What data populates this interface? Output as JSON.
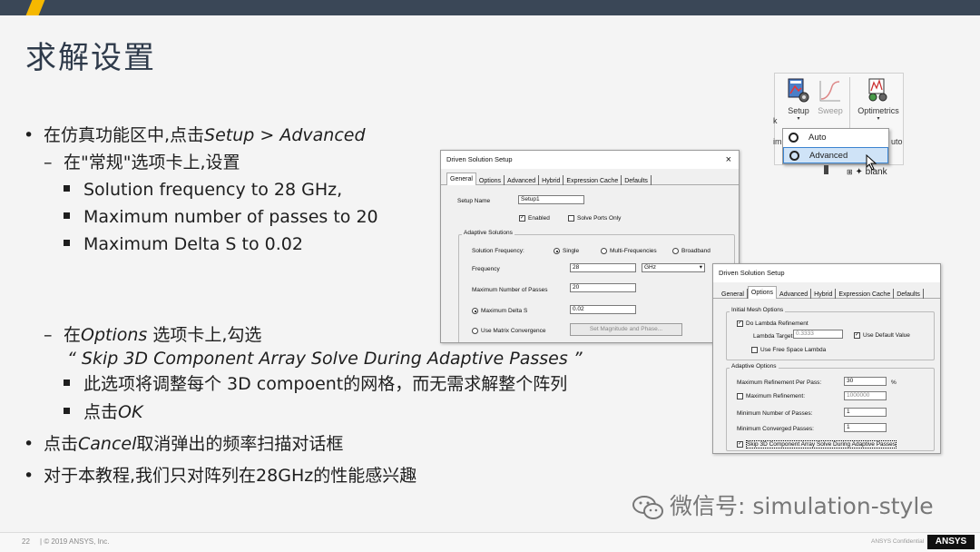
{
  "slide": {
    "title": "求解设置",
    "page_number": "22",
    "copyright": "© 2019 ANSYS, Inc.",
    "confidential": "ANSYS Confidential",
    "logo": "ANSYS",
    "watermark": "微信号: simulation-style"
  },
  "bullets": {
    "b1_prefix": "在仿真功能区中,点击",
    "b1_em": "Setup > Advanced",
    "b1_1": "在\"常规\"选项卡上,设置",
    "b1_1_a": "Solution frequency to 28 GHz,",
    "b1_1_b": "Maximum number of passes to 20",
    "b1_1_c": "Maximum Delta S to 0.02",
    "b1_2_prefix": "在",
    "b1_2_em": "Options",
    "b1_2_suffix": " 选项卡上,勾选",
    "b1_2_quote": "“ Skip 3D Component Array Solve During Adaptive Passes ”",
    "b1_2_a": "此选项将调整每个 3D compoent的网格，而无需求解整个阵列",
    "b1_2_b_prefix": "点击",
    "b1_2_b_em": "OK",
    "b2_prefix": "点击",
    "b2_em": "Cancel",
    "b2_suffix": "取消弹出的频率扫描对话框",
    "b3": "对于本教程,我们只对阵列在28GHz的性能感兴趣"
  },
  "ribbon": {
    "setup_label": "Setup",
    "sweep_label": "Sweep",
    "optimetrics_label": "Optimetrics",
    "menu_auto": "Auto",
    "menu_advanced": "Advanced",
    "partial_left_k": "k",
    "partial_left_im": "im",
    "partial_right": "uto",
    "tree_item": "blank"
  },
  "dialog1": {
    "title": "Driven Solution Setup",
    "close": "×",
    "tabs": [
      "General",
      "Options",
      "Advanced",
      "Hybrid",
      "Expression Cache",
      "Defaults"
    ],
    "setup_name_label": "Setup Name",
    "setup_name_value": "Setup1",
    "enabled_label": "Enabled",
    "solve_ports_label": "Solve Ports Only",
    "adaptive_group": "Adaptive Solutions",
    "sol_freq_label": "Solution Frequency:",
    "single": "Single",
    "multi": "Multi-Frequencies",
    "broadband": "Broadband",
    "frequency_label": "Frequency",
    "frequency_value": "28",
    "unit_value": "GHz",
    "max_passes_label": "Maximum Number of Passes",
    "max_passes_value": "20",
    "max_delta_label": "Maximum Delta S",
    "max_delta_value": "0.02",
    "matrix_conv_label": "Use Matrix Convergence",
    "set_mag_btn": "Set Magnitude and Phase..."
  },
  "dialog2": {
    "title": "Driven Solution Setup",
    "tabs": [
      "General",
      "Options",
      "Advanced",
      "Hybrid",
      "Expression Cache",
      "Defaults"
    ],
    "initial_mesh_group": "Initial Mesh Options",
    "do_lambda": "Do Lambda Refinement",
    "lambda_target_label": "Lambda Target:",
    "lambda_target_value": "0.3333",
    "use_default": "Use Default Value",
    "free_space": "Use Free Space Lambda",
    "adaptive_group": "Adaptive Options",
    "max_ref_per_pass_label": "Maximum Refinement Per Pass:",
    "max_ref_per_pass_value": "30",
    "percent": "%",
    "max_ref_label": "Maximum Refinement:",
    "max_ref_value": "1000000",
    "min_passes_label": "Minimum Number of Passes:",
    "min_passes_value": "1",
    "min_conv_label": "Minimum Converged Passes:",
    "min_conv_value": "1",
    "skip_label": "Skip 3D Component Array Solve During Adaptive Passes"
  }
}
